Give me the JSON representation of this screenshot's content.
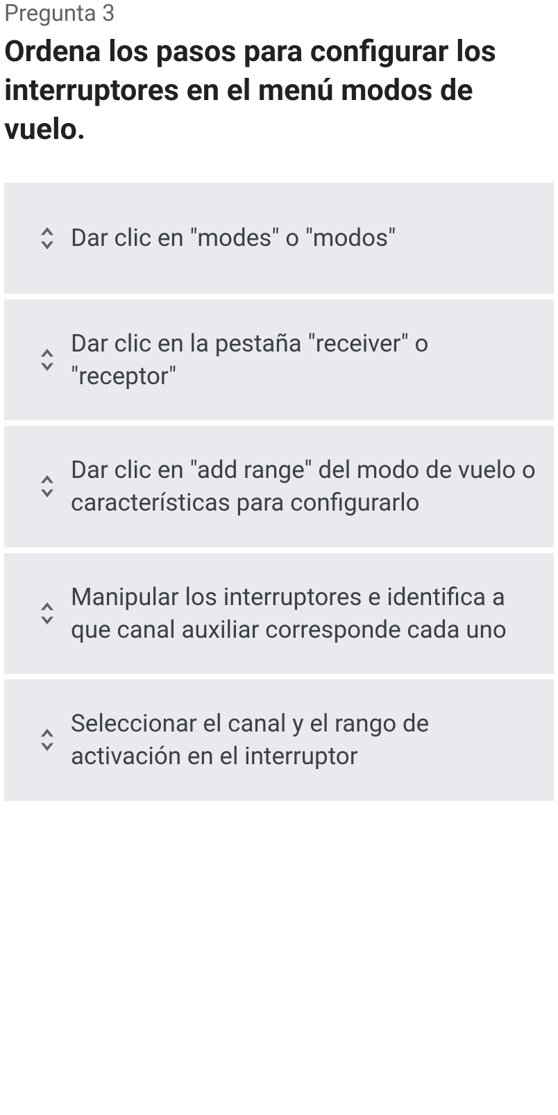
{
  "question": {
    "label": "Pregunta 3",
    "text": "Ordena los pasos para configurar los interruptores en el menú modos de vuelo."
  },
  "options": [
    {
      "text": "Dar clic en \"modes\" o \"modos\""
    },
    {
      "text": "Dar clic en la pestaña \"receiver\" o \"receptor\""
    },
    {
      "text": "Dar clic en \"add range\" del modo de vuelo o características para configurarlo"
    },
    {
      "text": "Manipular los interruptores e identifica a que canal auxiliar corresponde cada uno"
    },
    {
      "text": "Seleccionar el canal y el rango de activación en el interruptor"
    }
  ]
}
